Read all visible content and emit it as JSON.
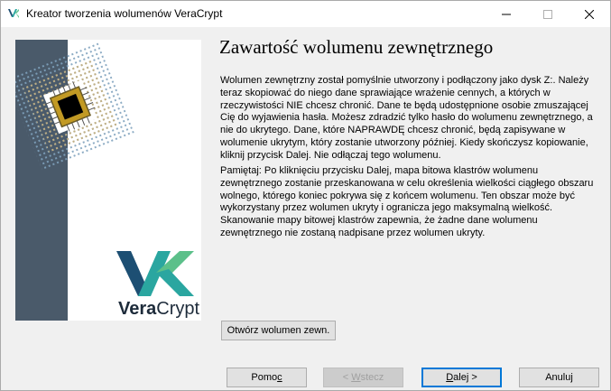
{
  "window": {
    "title": "Kreator tworzenia wolumenów VeraCrypt",
    "controls": {
      "minimize_icon": "minimize-icon",
      "maximize_icon": "maximize-icon",
      "close_icon": "close-icon"
    }
  },
  "sidebar": {
    "logo_text_vera": "Vera",
    "logo_text_crypt": "Crypt",
    "colors": {
      "stripe": "#4a5a6a",
      "logo_dark": "#1d4f73",
      "logo_teal": "#2aa6a0",
      "logo_green": "#5cc08a"
    }
  },
  "page": {
    "heading": "Zawartość wolumenu zewnętrznego",
    "paragraph1": "Wolumen zewnętrzny został pomyślnie utworzony i podłączony jako dysk Z:. Należy teraz skopiować do niego dane sprawiające wrażenie cennych, a których w rzeczywistości NIE chcesz chronić. Dane te będą udostępnione osobie zmuszającej Cię do wyjawienia hasła. Możesz zdradzić tylko hasło do wolumenu zewnętrznego, a nie do ukrytego. Dane, które NAPRAWDĘ chcesz chronić, będą zapisywane w wolumenie ukrytym, który zostanie utworzony później. Kiedy skończysz kopiowanie, kliknij przycisk Dalej. Nie odłączaj tego wolumenu.",
    "paragraph2": "Pamiętaj: Po kliknięciu przycisku Dalej, mapa bitowa klastrów wolumenu zewnętrznego zostanie przeskanowana w celu określenia wielkości ciągłego obszaru wolnego, którego koniec pokrywa się z końcem wolumenu. Ten obszar może być wykorzystany przez wolumen ukryty i ogranicza jego maksymalną wielkość. Skanowanie mapy bitowej klastrów zapewnia, że żadne dane wolumenu zewnętrznego nie zostaną nadpisane przez wolumen ukryty.",
    "open_outer_button": "Otwórz wolumen zewn."
  },
  "footer": {
    "help": {
      "before": "Pomo",
      "underlined": "c",
      "after": ""
    },
    "back": {
      "before": "< ",
      "underlined": "W",
      "after": "stecz"
    },
    "next": {
      "before": "",
      "underlined": "D",
      "after": "alej >"
    },
    "cancel": "Anuluj"
  }
}
